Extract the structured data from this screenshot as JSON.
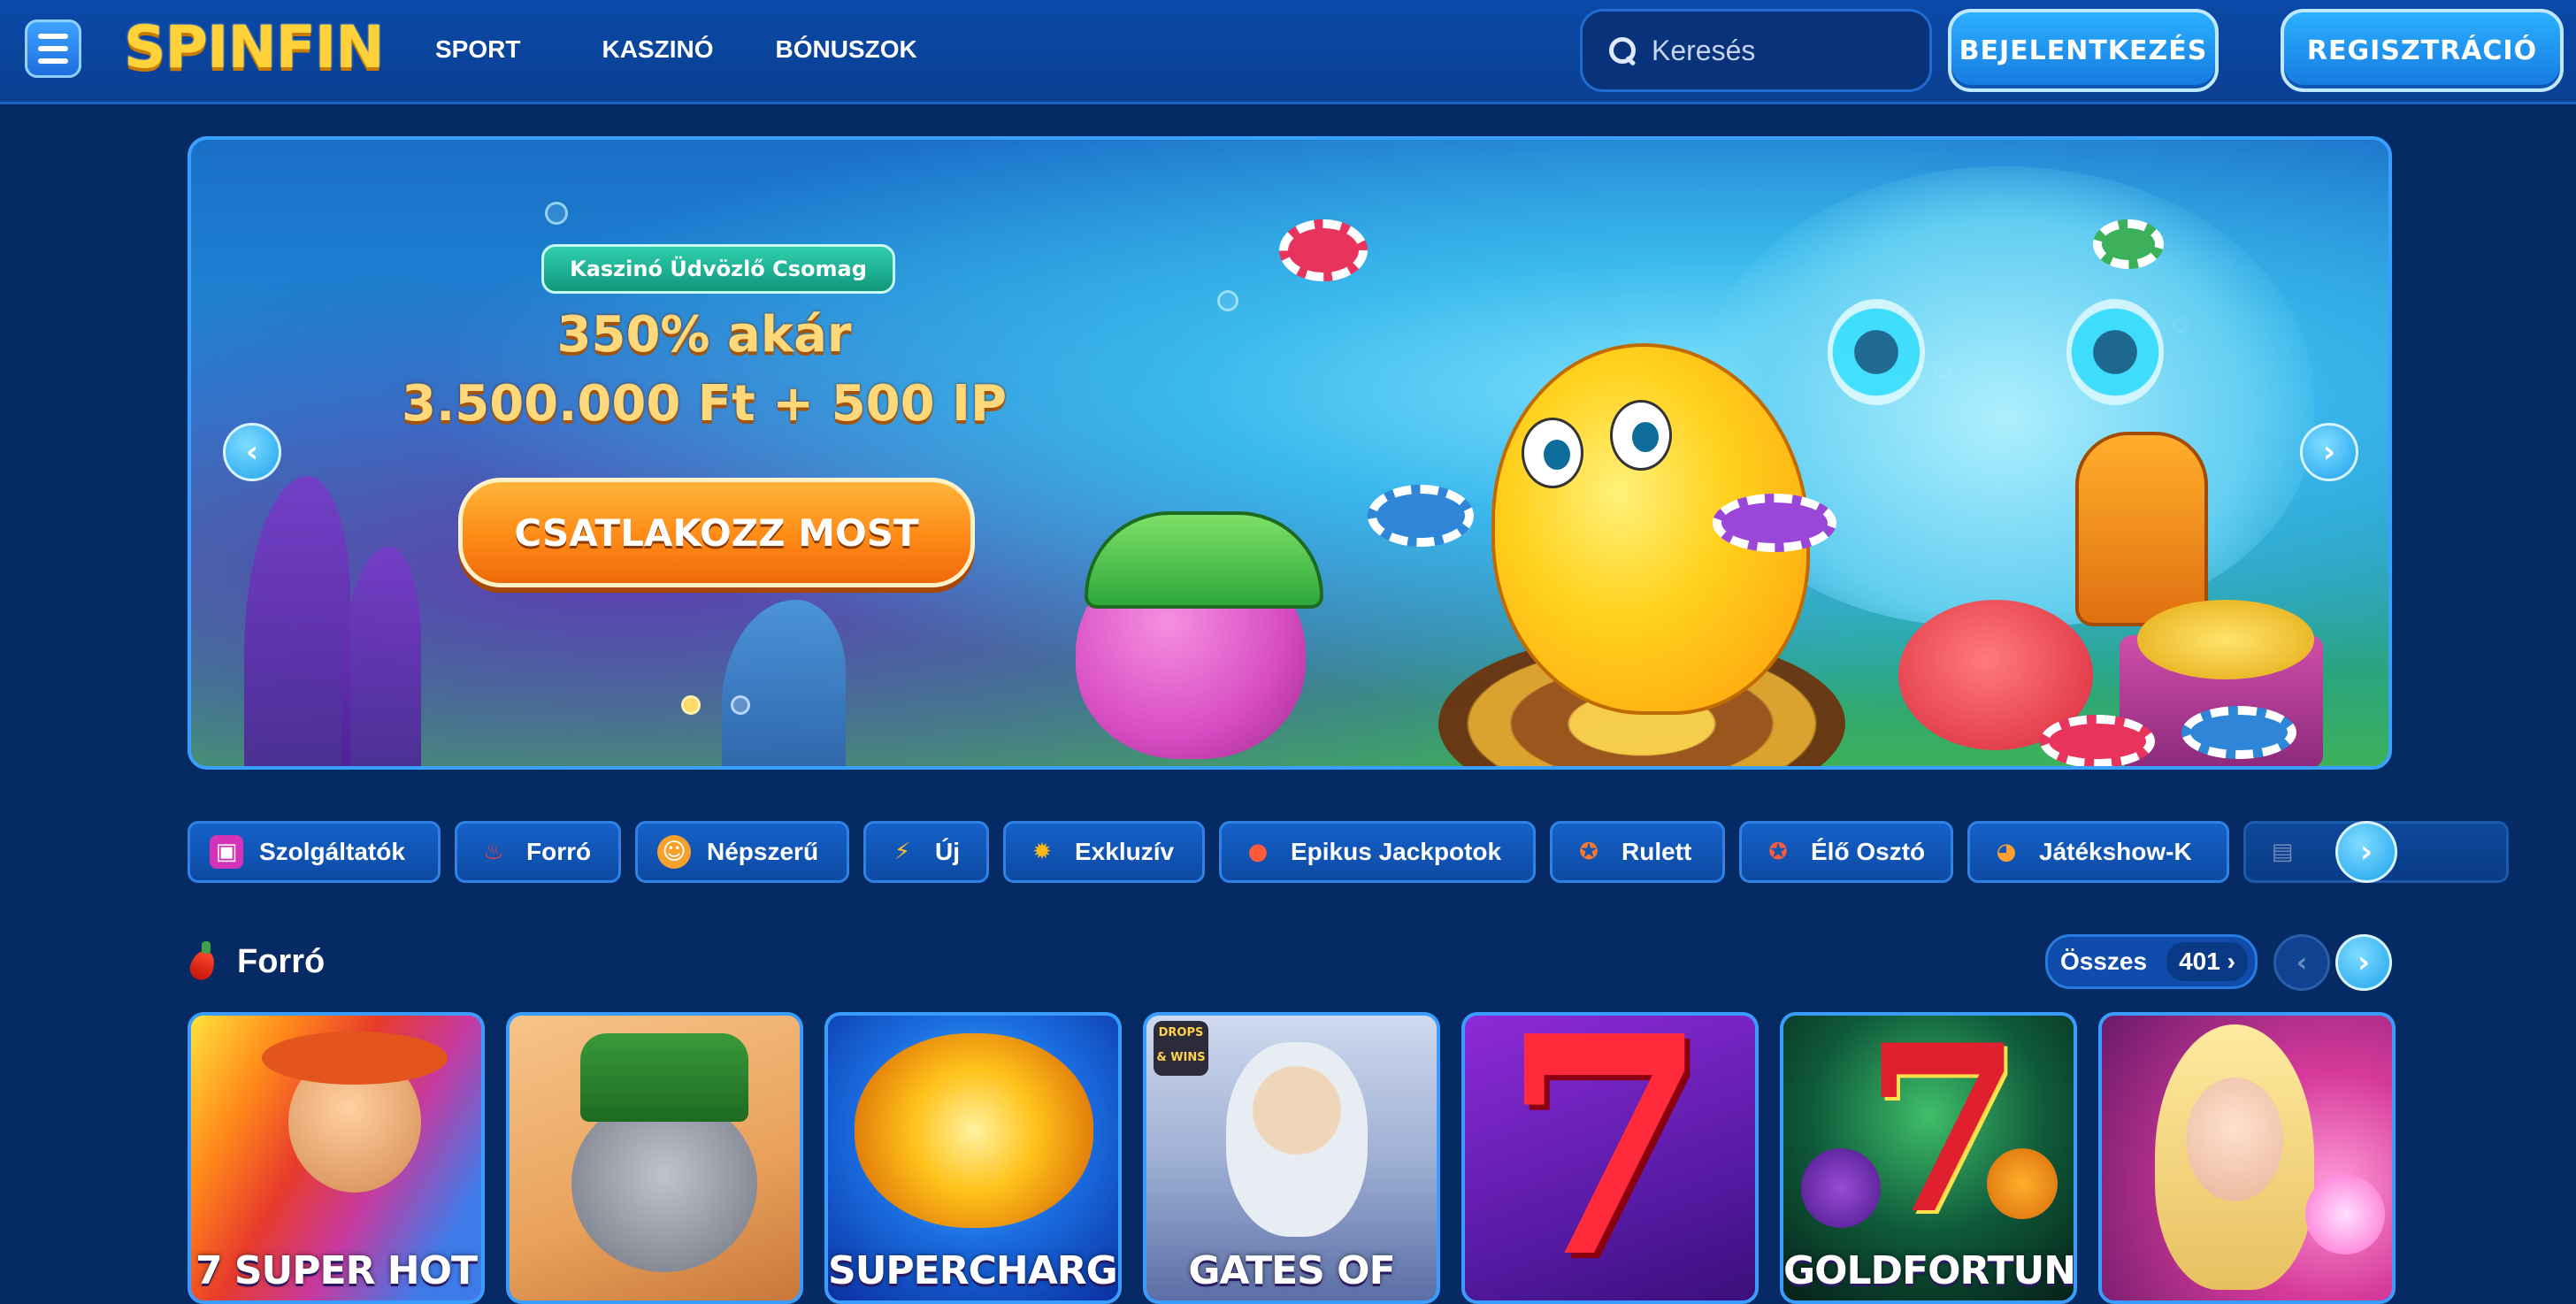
{
  "header": {
    "logo_text": "SPINFIN",
    "nav": [
      "SPORT",
      "KASZINÓ",
      "BÓNUSZOK"
    ],
    "search_placeholder": "Keresés",
    "login_label": "BEJELENTKEZÉS",
    "register_label": "REGISZTRÁCIÓ"
  },
  "banner": {
    "badge": "Kaszinó Üdvözlő Csomag",
    "line1": "350% akár",
    "line2": "3.500.000 Ft + 500 IP",
    "cta": "CSATLAKOZZ MOST",
    "prev_icon": "chevron-left-icon",
    "next_icon": "chevron-right-icon",
    "slides_total": 2,
    "active_slide": 1
  },
  "categories": [
    {
      "label": "Szolgáltatók",
      "icon": "providers-icon"
    },
    {
      "label": "Forró",
      "icon": "chili-icon"
    },
    {
      "label": "Népszerű",
      "icon": "popular-icon"
    },
    {
      "label": "Új",
      "icon": "lightning-icon"
    },
    {
      "label": "Exkluzív",
      "icon": "star-burst-icon"
    },
    {
      "label": "Epikus Jackpotok",
      "icon": "jackpot-icon"
    },
    {
      "label": "Rulett",
      "icon": "roulette-icon"
    },
    {
      "label": "Élő Osztó",
      "icon": "live-dealer-icon"
    },
    {
      "label": "Játékshow-K",
      "icon": "game-show-icon"
    },
    {
      "label": "",
      "icon": "cards-icon"
    }
  ],
  "section": {
    "title": "Forró",
    "all_label": "Összes",
    "all_count": "401"
  },
  "games": [
    {
      "title": "7 SUPER HOT",
      "theme": "mexican-rainbow"
    },
    {
      "title": "",
      "theme": "leprechaun-raccoon"
    },
    {
      "title": "SUPERCHARGED",
      "theme": "golden-clover"
    },
    {
      "title": "GATES OF",
      "theme": "zeus",
      "badge": "DROPS & WINS"
    },
    {
      "title": "",
      "theme": "lucky-seven"
    },
    {
      "title": "GOLDFORTUNE",
      "theme": "fruit-seven"
    },
    {
      "title": "",
      "theme": "blonde-magic"
    }
  ],
  "colors": {
    "background": "#062a63",
    "header": "#0a4aa8",
    "accent": "#1ea3ee",
    "cta": "#ff8a16",
    "gold_text": "#ffd87a"
  }
}
